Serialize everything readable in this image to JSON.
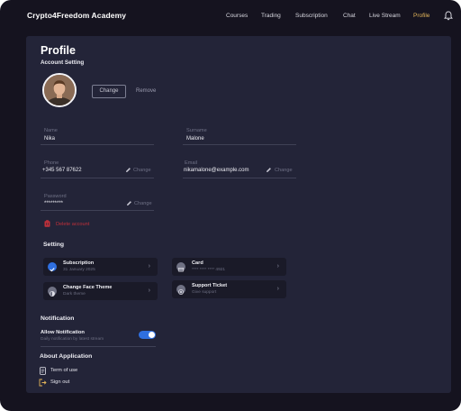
{
  "app": {
    "brand": "Crypto4Freedom Academy"
  },
  "nav": {
    "items": [
      "Courses",
      "Trading",
      "Subscription",
      "Chat",
      "Live Stream",
      "Profile"
    ],
    "active": "Profile",
    "bell_icon": "bell-icon"
  },
  "colors": {
    "background": "#15131f",
    "panel": "#232438",
    "accent": "#e2b45a",
    "danger": "#c0303a",
    "toggle": "#2f6fe0"
  },
  "profile": {
    "title": "Profile",
    "account_setting": "Account Setting",
    "change_label": "Change",
    "remove_label": "Remove"
  },
  "fields": {
    "name": {
      "label": "Name",
      "value": "Nika"
    },
    "surname": {
      "label": "Surname",
      "value": "Malone"
    },
    "phone": {
      "label": "Phone",
      "value": "+345 567 87622",
      "action": "Change"
    },
    "email": {
      "label": "Email",
      "value": "nikamalone@example.com",
      "action": "Change"
    },
    "password": {
      "label": "Password",
      "value": "*********",
      "action": "Change"
    }
  },
  "delete_account": "Delete account",
  "setting": {
    "heading": "Setting",
    "cards": {
      "subscription": {
        "title": "Subscription",
        "sub": "31 January 2025"
      },
      "card": {
        "title": "Card",
        "sub": "**** **** **** 4921"
      },
      "theme": {
        "title": "Change Face Theme",
        "sub": "Dark theme"
      },
      "support": {
        "title": "Support Ticket",
        "sub": "Give support"
      }
    }
  },
  "notification": {
    "heading": "Notification",
    "allow_title": "Allow Notification",
    "allow_sub": "Daily notification by latest stream",
    "enabled": true
  },
  "about": {
    "heading": "About Application",
    "terms": "Term of use",
    "signout": "Sign out"
  }
}
